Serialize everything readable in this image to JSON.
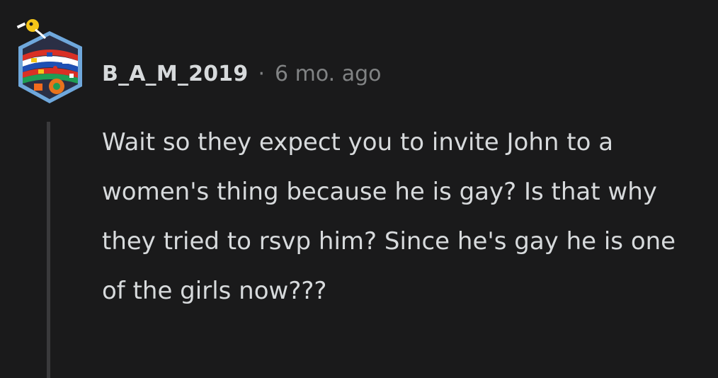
{
  "comment": {
    "username": "B_A_M_2019",
    "separator": "·",
    "timestamp": "6 mo. ago",
    "body": "Wait so they expect you to invite John to a women's thing because he is gay? Is that why they tried to rsvp him? Since he's gay he is one of the girls now???"
  },
  "avatar": {
    "icon": "world-cup-flags-avatar-icon",
    "colors": {
      "frame": "#6fa8dc",
      "ball": "#f5c518",
      "red": "#d93025",
      "body": "#2a2f45"
    }
  },
  "theme": {
    "background": "#1a1a1b",
    "text": "#d7dadc",
    "muted": "#818384",
    "thread_line": "#3a3a3c"
  }
}
